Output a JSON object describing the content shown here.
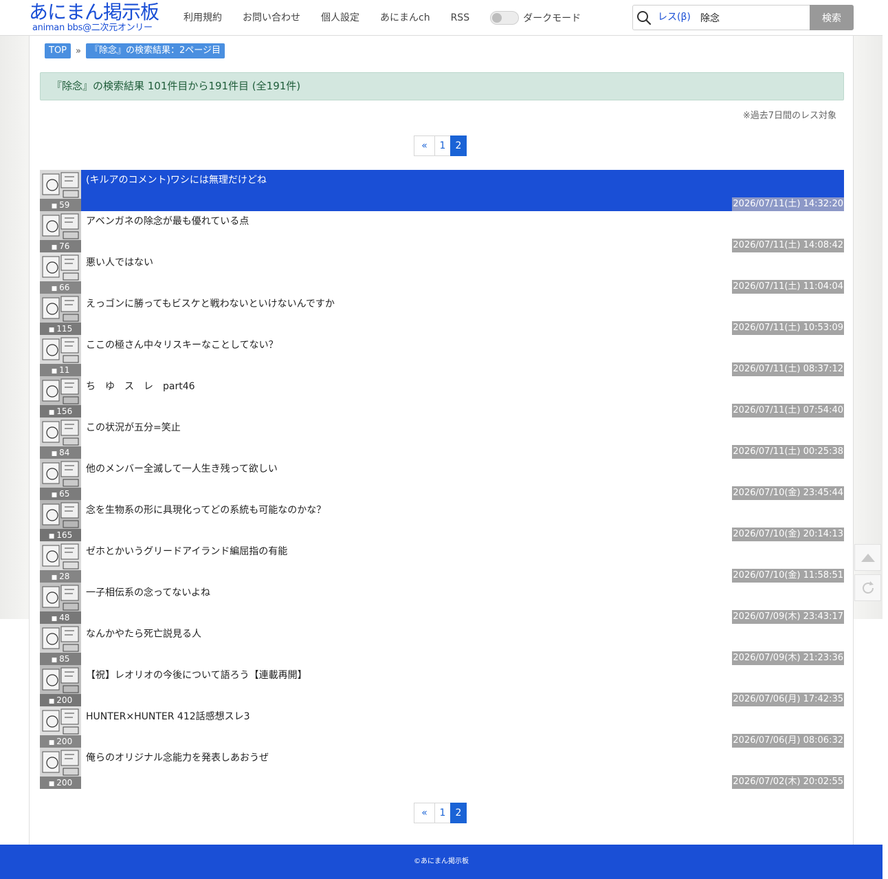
{
  "header": {
    "logo_main": "あにまん掲示板",
    "logo_sub": "animan bbs@二次元オンリー",
    "nav": [
      "利用規約",
      "お問い合わせ",
      "個人設定",
      "あにまんch",
      "RSS"
    ],
    "dark_mode_label": "ダークモード",
    "dark_mode_on": false,
    "search_scope": "レス(β)",
    "search_value": "除念",
    "search_button": "検索"
  },
  "breadcrumb": {
    "top": "TOP",
    "sep": "»",
    "current": "『除念』の検索結果：2ページ目"
  },
  "result_summary": "『除念』の検索結果 101件目から191件目 (全191件)",
  "note": "※過去7日間のレス対象",
  "pager": {
    "first": "«",
    "pages": [
      "1",
      "2"
    ],
    "current": "2"
  },
  "threads": [
    {
      "title": "(キルアのコメント)ワシには無理だけどね",
      "count": "59",
      "date": "2026/07/11(土) 14:32:20",
      "highlighted": true
    },
    {
      "title": "アベンガネの除念が最も優れている点",
      "count": "76",
      "date": "2026/07/11(土) 14:08:42"
    },
    {
      "title": "悪い人ではない",
      "count": "66",
      "date": "2026/07/11(土) 11:04:04"
    },
    {
      "title": "えっゴンに勝ってもビスケと戦わないといけないんですか",
      "count": "115",
      "date": "2026/07/11(土) 10:53:09"
    },
    {
      "title": "ここの極さん中々リスキーなことしてない？",
      "count": "11",
      "date": "2026/07/11(土) 08:37:12"
    },
    {
      "title": "ち　ゆ　ス　レ　part46",
      "count": "156",
      "date": "2026/07/11(土) 07:54:40"
    },
    {
      "title": "この状況が五分=笑止",
      "count": "84",
      "date": "2026/07/11(土) 00:25:38"
    },
    {
      "title": "他のメンバー全滅して一人生き残って欲しい",
      "count": "65",
      "date": "2026/07/10(金) 23:45:44"
    },
    {
      "title": "念を生物系の形に具現化ってどの系統も可能なのかな？",
      "count": "165",
      "date": "2026/07/10(金) 20:14:13"
    },
    {
      "title": "ゼホとかいうグリードアイランド編屈指の有能",
      "count": "28",
      "date": "2026/07/10(金) 11:58:51"
    },
    {
      "title": "一子相伝系の念ってないよね",
      "count": "48",
      "date": "2026/07/09(木) 23:43:17"
    },
    {
      "title": "なんかやたら死亡説見る人",
      "count": "85",
      "date": "2026/07/09(木) 21:23:36"
    },
    {
      "title": "【祝】レオリオの今後について語ろう【連載再開】",
      "count": "200",
      "date": "2026/07/06(月) 17:42:35"
    },
    {
      "title": "HUNTER×HUNTER 412話感想スレ3",
      "count": "200",
      "date": "2026/07/06(月) 08:06:32"
    },
    {
      "title": "俺らのオリジナル念能力を発表しあおうぜ",
      "count": "200",
      "date": "2026/07/02(木) 20:02:55"
    }
  ],
  "footer": "©あにまん掲示板",
  "colors": {
    "brand": "#1a4fd6",
    "highlight_row": "#1a4fd6",
    "result_box_bg": "#d3e7df",
    "date_badge": "#a4a4a4"
  }
}
